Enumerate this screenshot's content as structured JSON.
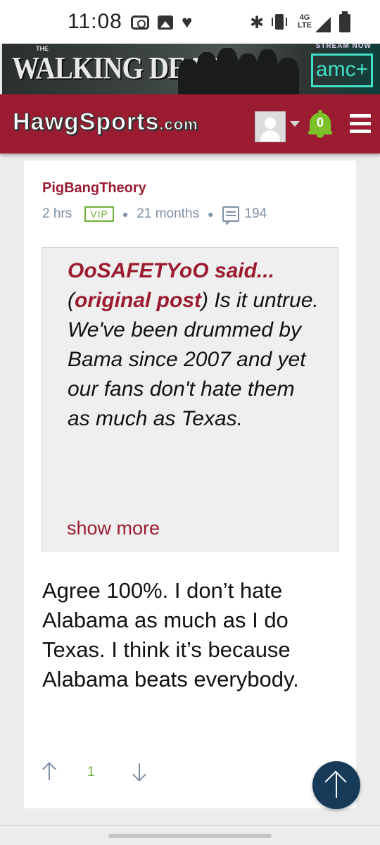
{
  "status_bar": {
    "time": "11:08",
    "network": "4G LTE",
    "icons": [
      "camera-icon",
      "image-icon",
      "heart-icon",
      "bluetooth-icon",
      "vibrate-icon",
      "signal-icon",
      "battery-icon"
    ]
  },
  "ad": {
    "small_the": "THE",
    "title": "WALKING DEAD",
    "stream": "STREAM NOW",
    "brand": "amc+"
  },
  "header": {
    "logo_main": "HawgSports",
    "logo_suffix": ".com",
    "notifications_count": "0",
    "colors": {
      "brand": "#9b1c31",
      "bell": "#7cc12a"
    }
  },
  "post": {
    "author": "PigBangTheory",
    "time_ago": "2 hrs",
    "badge": "VIP",
    "membership": "21 months",
    "comment_count": "194",
    "quote": {
      "author_said": "OoSAFETYoO said...",
      "paren_open": "(",
      "link_label": "original post",
      "paren_close": ")",
      "text": "Is it untrue. We've been drummed by Bama since 2007 and yet our fans don't hate them as much as Texas.",
      "show_more": "show more"
    },
    "body": "Agree 100%. I don’t hate Alabama as much as I do Texas. I think it’s because Alabama beats everybody.",
    "votes": "1",
    "more": "…"
  }
}
